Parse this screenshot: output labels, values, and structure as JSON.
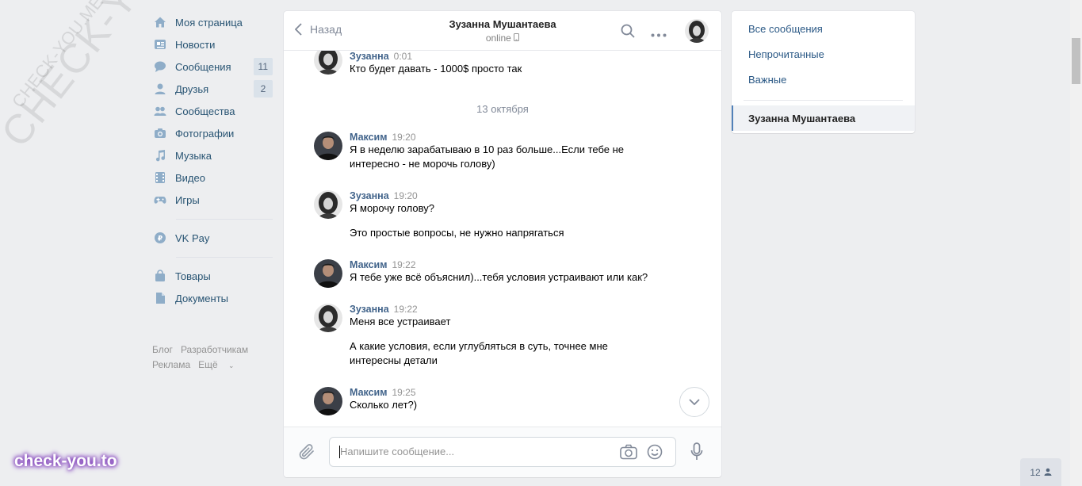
{
  "watermark": {
    "big": "CHECK-YOU.ME",
    "small": "CHECK-YOU.ME",
    "corner": "check-you.to"
  },
  "nav": {
    "items": [
      {
        "label": "Моя страница",
        "icon": "home-icon"
      },
      {
        "label": "Новости",
        "icon": "news-icon"
      },
      {
        "label": "Сообщения",
        "icon": "messages-icon",
        "count": "11"
      },
      {
        "label": "Друзья",
        "icon": "friends-icon",
        "count": "2"
      },
      {
        "label": "Сообщества",
        "icon": "groups-icon"
      },
      {
        "label": "Фотографии",
        "icon": "camera-icon"
      },
      {
        "label": "Музыка",
        "icon": "music-icon"
      },
      {
        "label": "Видео",
        "icon": "video-icon"
      },
      {
        "label": "Игры",
        "icon": "gamepad-icon"
      }
    ],
    "vkpay": {
      "label": "VK Pay",
      "icon": "vkpay-icon"
    },
    "extra": [
      {
        "label": "Товары",
        "icon": "bag-icon"
      },
      {
        "label": "Документы",
        "icon": "document-icon"
      }
    ],
    "footer": {
      "blog": "Блог",
      "developers": "Разработчикам",
      "ads": "Реклама",
      "more": "Ещё"
    }
  },
  "chat": {
    "back_label": "Назад",
    "title": "Зузанна Мушантаева",
    "status": "online",
    "date_separator": "13 октября",
    "messages": [
      {
        "author": "Зузанна",
        "time": "0:01",
        "texts": [
          "Кто будет давать - 1000$ просто так"
        ]
      },
      {
        "author": "Максим",
        "time": "19:20",
        "texts": [
          "Я в неделю зарабатываю в 10 раз больше...Если тебе не интересно - не морочь голову)"
        ]
      },
      {
        "author": "Зузанна",
        "time": "19:20",
        "texts": [
          "Я морочу голову?",
          "Это простые вопросы, не нужно напрягаться"
        ]
      },
      {
        "author": "Максим",
        "time": "19:22",
        "texts": [
          "Я тебе уже всё объяснил)...тебя условия устраивают или как?"
        ]
      },
      {
        "author": "Зузанна",
        "time": "19:22",
        "texts": [
          "Меня все устраивает",
          "А какие условия, если углубляться в суть, точнее мне интересны детали"
        ]
      },
      {
        "author": "Максим",
        "time": "19:25",
        "texts": [
          "Сколько лет?)"
        ]
      }
    ],
    "composer_placeholder": "Напишите сообщение..."
  },
  "right_panel": {
    "all": "Все сообщения",
    "unread": "Непрочитанные",
    "important": "Важные",
    "active_dialog": "Зузанна Мушантаева"
  },
  "online_count": "12",
  "colors": {
    "link": "#2a5885",
    "author": "#42648b",
    "badge_bg": "#dae2ea",
    "accent": "#5181b8"
  }
}
